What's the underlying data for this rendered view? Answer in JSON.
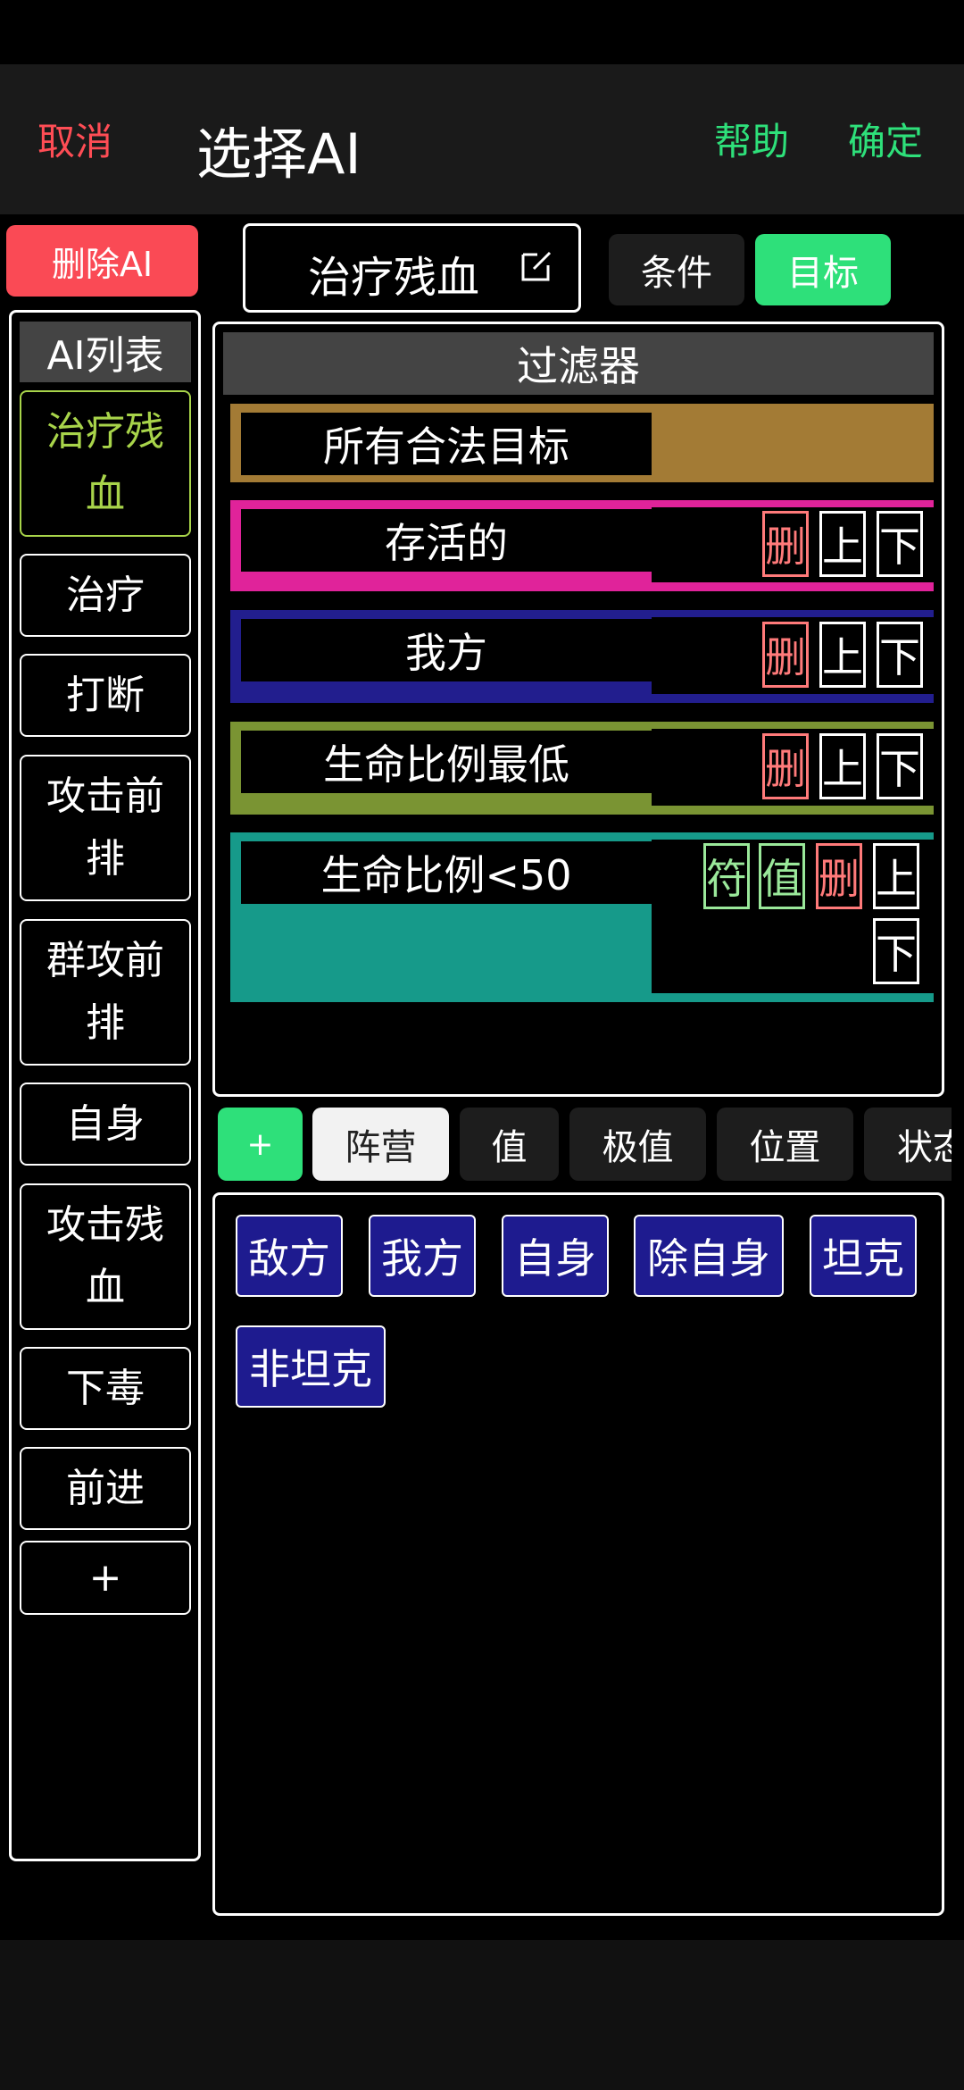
{
  "header": {
    "cancel": "取消",
    "title": "选择AI",
    "help": "帮助",
    "confirm": "确定"
  },
  "toolbar": {
    "delete_ai": "删除AI",
    "ai_name": "治疗残血",
    "tab_condition": "条件",
    "tab_target": "目标"
  },
  "sidebar": {
    "title": "AI列表",
    "items": [
      {
        "label": "治疗残血"
      },
      {
        "label": "治疗"
      },
      {
        "label": "打断"
      },
      {
        "label": "攻击前排"
      },
      {
        "label": "群攻前排"
      },
      {
        "label": "自身"
      },
      {
        "label": "攻击残血"
      },
      {
        "label": "下毒"
      },
      {
        "label": "前进"
      },
      {
        "label": "+"
      }
    ]
  },
  "filter": {
    "title": "过滤器",
    "rules": [
      {
        "label": "所有合法目标",
        "color": "#a37b35"
      },
      {
        "label": "存活的",
        "color": "#e0239a"
      },
      {
        "label": "我方",
        "color": "#221e8e"
      },
      {
        "label": "生命比例最低",
        "color": "#7a9433"
      },
      {
        "label": "生命比例<50",
        "color": "#169a8a"
      }
    ],
    "actions": {
      "del": "删",
      "up": "上",
      "down": "下",
      "symbol": "符",
      "value": "值"
    }
  },
  "categories": {
    "add": "+",
    "items": [
      "阵营",
      "值",
      "极值",
      "位置",
      "状态"
    ]
  },
  "options": [
    "敌方",
    "我方",
    "自身",
    "除自身",
    "坦克",
    "非坦克"
  ],
  "colors": {
    "accent_green": "#2ee07a",
    "danger_red": "#fa4a55",
    "option_blue": "#1e1b8f"
  }
}
